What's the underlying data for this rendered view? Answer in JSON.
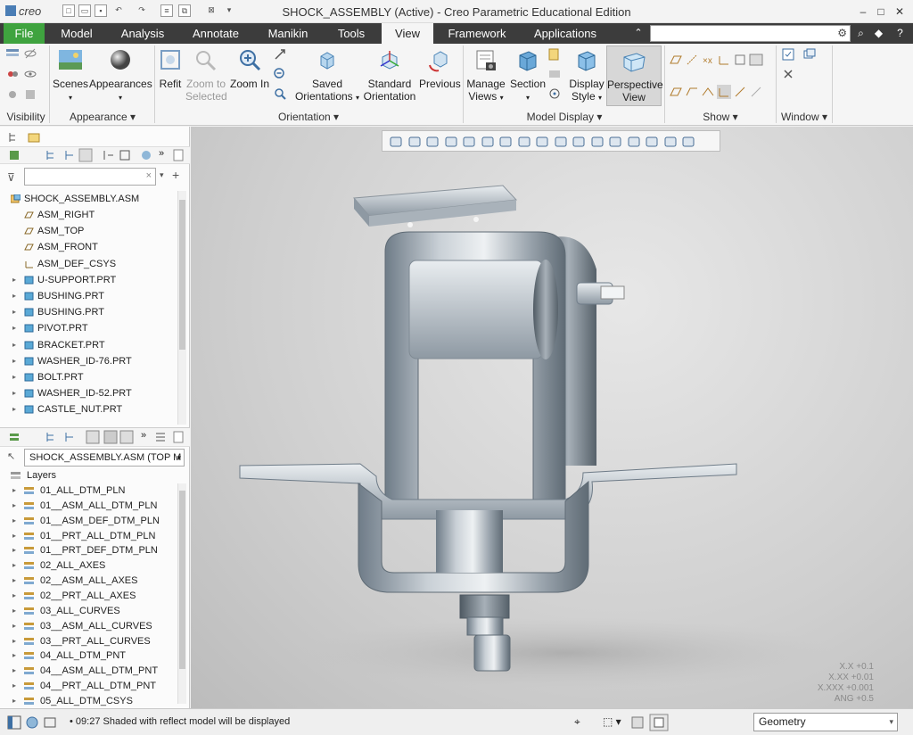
{
  "app": {
    "logo_text": "creo",
    "window_title": "SHOCK_ASSEMBLY (Active) - Creo Parametric Educational Edition"
  },
  "menu": {
    "tabs": [
      {
        "label": "File"
      },
      {
        "label": "Model"
      },
      {
        "label": "Analysis"
      },
      {
        "label": "Annotate"
      },
      {
        "label": "Manikin"
      },
      {
        "label": "Tools"
      },
      {
        "label": "View"
      },
      {
        "label": "Framework"
      },
      {
        "label": "Applications"
      }
    ],
    "active_tab": "View"
  },
  "ribbon": {
    "groups": {
      "visibility": "Visibility",
      "appearance": "Appearance",
      "orientation": "Orientation",
      "model_display": "Model Display",
      "show": "Show",
      "window": "Window"
    },
    "buttons": {
      "scenes": "Scenes",
      "appearances": "Appearances",
      "refit": "Refit",
      "zoom_to_selected_1": "Zoom to",
      "zoom_to_selected_2": "Selected",
      "zoom_in": "Zoom In",
      "saved_orientations_1": "Saved",
      "saved_orientations_2": "Orientations",
      "standard_orientation_1": "Standard",
      "standard_orientation_2": "Orientation",
      "previous": "Previous",
      "manage_views_1": "Manage",
      "manage_views_2": "Views",
      "section": "Section",
      "display_style_1": "Display",
      "display_style_2": "Style",
      "perspective_view_1": "Perspective",
      "perspective_view_2": "View"
    }
  },
  "model_tree": {
    "root": "SHOCK_ASSEMBLY.ASM",
    "items": [
      {
        "label": "ASM_RIGHT",
        "kind": "plane"
      },
      {
        "label": "ASM_TOP",
        "kind": "plane"
      },
      {
        "label": "ASM_FRONT",
        "kind": "plane"
      },
      {
        "label": "ASM_DEF_CSYS",
        "kind": "csys"
      },
      {
        "label": "U-SUPPORT.PRT",
        "kind": "part"
      },
      {
        "label": "BUSHING.PRT",
        "kind": "part"
      },
      {
        "label": "BUSHING.PRT",
        "kind": "part"
      },
      {
        "label": "PIVOT.PRT",
        "kind": "part"
      },
      {
        "label": "BRACKET.PRT",
        "kind": "part"
      },
      {
        "label": "WASHER_ID-76.PRT",
        "kind": "part"
      },
      {
        "label": "BOLT.PRT",
        "kind": "part"
      },
      {
        "label": "WASHER_ID-52.PRT",
        "kind": "part"
      },
      {
        "label": "CASTLE_NUT.PRT",
        "kind": "part"
      }
    ]
  },
  "layer_tree": {
    "selector_value": "SHOCK_ASSEMBLY.ASM (TOP M",
    "header": "Layers",
    "items": [
      {
        "label": "01_ALL_DTM_PLN"
      },
      {
        "label": "01__ASM_ALL_DTM_PLN"
      },
      {
        "label": "01__ASM_DEF_DTM_PLN"
      },
      {
        "label": "01__PRT_ALL_DTM_PLN"
      },
      {
        "label": "01__PRT_DEF_DTM_PLN"
      },
      {
        "label": "02_ALL_AXES"
      },
      {
        "label": "02__ASM_ALL_AXES"
      },
      {
        "label": "02__PRT_ALL_AXES"
      },
      {
        "label": "03_ALL_CURVES"
      },
      {
        "label": "03__ASM_ALL_CURVES"
      },
      {
        "label": "03__PRT_ALL_CURVES"
      },
      {
        "label": "04_ALL_DTM_PNT"
      },
      {
        "label": "04__ASM_ALL_DTM_PNT"
      },
      {
        "label": "04__PRT_ALL_DTM_PNT"
      },
      {
        "label": "05_ALL_DTM_CSYS"
      }
    ]
  },
  "viewport": {
    "precision": [
      "X.X +0.1",
      "X.XX +0.01",
      "X.XXX +0.001",
      "ANG +0.5"
    ]
  },
  "status": {
    "message": "09:27  Shaded with reflect model will be displayed",
    "filter_value": "Geometry"
  },
  "colors": {
    "tab_bar": "#3c3c3c",
    "file_tab": "#3fa33f",
    "part_icon": "#5aa9d6"
  }
}
